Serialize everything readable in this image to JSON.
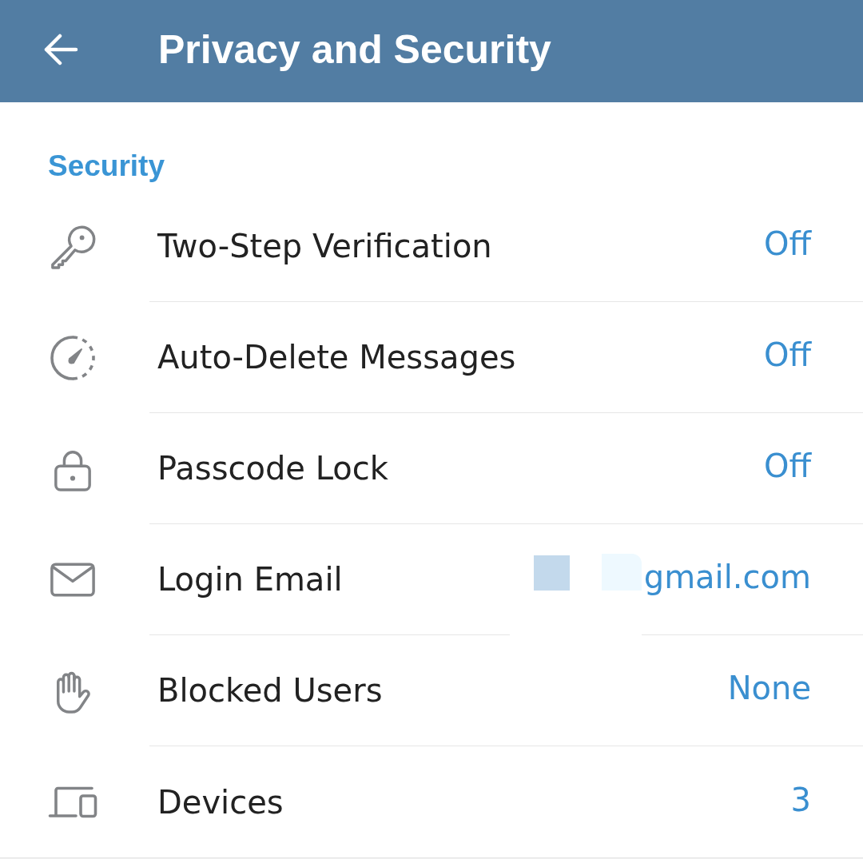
{
  "header": {
    "title": "Privacy and Security"
  },
  "section": {
    "title": "Security"
  },
  "rows": [
    {
      "kind": "key",
      "label": "Two-Step Verification",
      "value": "Off",
      "redacted": false
    },
    {
      "kind": "timer",
      "label": "Auto-Delete Messages",
      "value": "Off",
      "redacted": false
    },
    {
      "kind": "lock",
      "label": "Passcode Lock",
      "value": "Off",
      "redacted": false
    },
    {
      "kind": "mail",
      "label": "Login Email",
      "value": "gmail.com",
      "redacted": true
    },
    {
      "kind": "hand",
      "label": "Blocked Users",
      "value": "None",
      "redacted": false
    },
    {
      "kind": "devices",
      "label": "Devices",
      "value": "3",
      "redacted": false
    }
  ]
}
